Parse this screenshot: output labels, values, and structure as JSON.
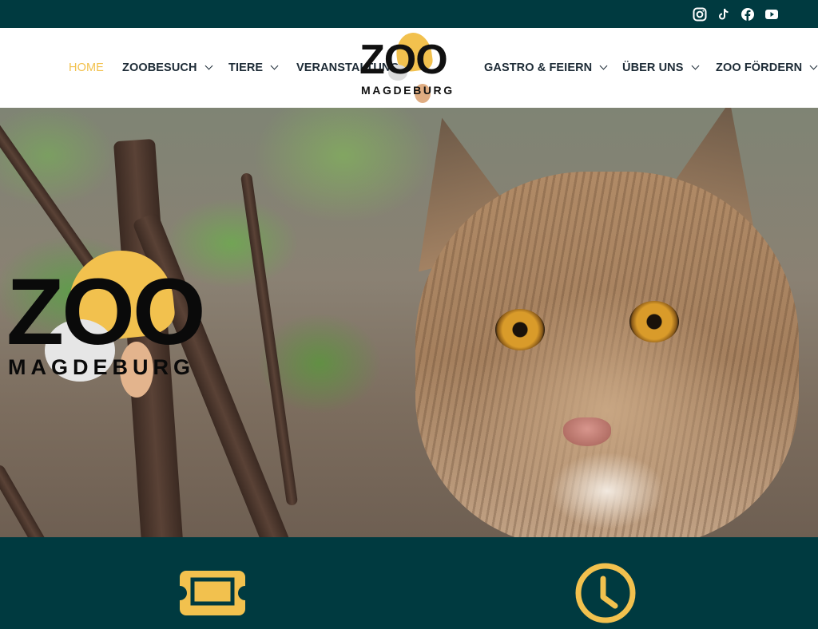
{
  "topbar": {
    "social": [
      {
        "name": "instagram-icon"
      },
      {
        "name": "tiktok-icon"
      },
      {
        "name": "facebook-icon"
      },
      {
        "name": "youtube-icon"
      }
    ]
  },
  "header": {
    "logo": {
      "main": "ZOO",
      "sub": "MAGDEBURG"
    },
    "nav": [
      {
        "label": "HOME",
        "active": true,
        "dropdown": false
      },
      {
        "label": "ZOOBESUCH",
        "active": false,
        "dropdown": true
      },
      {
        "label": "TIERE",
        "active": false,
        "dropdown": true
      },
      {
        "label": "VERANSTALTUNGEN",
        "active": false,
        "dropdown": false
      },
      {
        "label": "GASTRO & FEIERN",
        "active": false,
        "dropdown": true
      },
      {
        "label": "ÜBER UNS",
        "active": false,
        "dropdown": true
      },
      {
        "label": "ZOO FÖRDERN",
        "active": false,
        "dropdown": true
      }
    ]
  },
  "hero": {
    "logo": {
      "main": "ZOO",
      "sub": "MAGDEBURG"
    },
    "image": "lynx-photo"
  },
  "bottom": {
    "icons": [
      "ticket-icon",
      "clock-icon"
    ]
  },
  "colors": {
    "brand_dark": "#003a40",
    "accent_yellow": "#f2c14e",
    "nav_text": "#1d2b36"
  }
}
